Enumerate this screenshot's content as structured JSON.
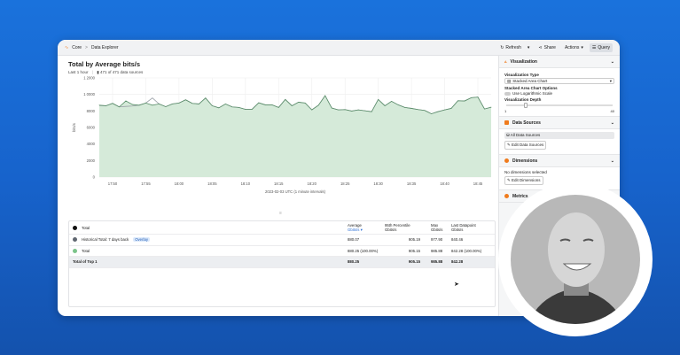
{
  "breadcrumb": {
    "root": "Core",
    "sep": ">",
    "page": "Data Explorer"
  },
  "toolbar": {
    "refresh": "Refresh",
    "share": "Share",
    "actions": "Actions",
    "query": "Query"
  },
  "chart_header": {
    "title": "Total by Average bits/s",
    "range": "Last 1 hour",
    "sources": "471 of 471 data sources"
  },
  "chart_data": {
    "type": "area",
    "title": "Total by Average bits/s",
    "xlabel": "2023-02-03 UTC (1 minute intervals)",
    "ylabel": "bits/s",
    "ylim": [
      0,
      12000
    ],
    "yticks": [
      "0",
      "2000",
      "4000",
      "6000",
      "8000",
      "1 0000",
      "1 2000"
    ],
    "xticks": [
      "17:50",
      "17:55",
      "18:00",
      "18:05",
      "18:10",
      "18:15",
      "18:20",
      "18:25",
      "18:30",
      "18:35",
      "18:40",
      "18:45"
    ],
    "x_start": "17:48",
    "x_step_min": 1,
    "series": [
      {
        "name": "Total",
        "color": "#5a8f6a",
        "fill": "#d5ead9",
        "values": [
          8700,
          8630,
          8920,
          8490,
          9210,
          8780,
          8700,
          8960,
          8700,
          8850,
          8520,
          8850,
          8960,
          9350,
          8920,
          8850,
          9570,
          8630,
          8380,
          8850,
          8490,
          8420,
          8200,
          8200,
          8990,
          8740,
          8740,
          8420,
          9390,
          8630,
          9060,
          8960,
          8130,
          8700,
          9860,
          8350,
          8130,
          8170,
          7990,
          8130,
          8020,
          7910,
          9390,
          8630,
          9170,
          8740,
          8420,
          8310,
          8170,
          8060,
          7660,
          7910,
          8130,
          8310,
          9240,
          9210,
          9600,
          9680,
          8240,
          8450
        ]
      },
      {
        "name": "Historical Total: 7 days back",
        "color": "#9aa0a6",
        "values": [
          8650,
          8630,
          8920,
          8490,
          8550,
          8600,
          8700,
          8960,
          9570,
          8850,
          8520,
          8850,
          8960,
          9350,
          8920,
          8850,
          9570,
          8630,
          8380,
          8850,
          8490,
          8420,
          8200,
          8200,
          8990,
          8740,
          8740,
          8420,
          9390,
          8630,
          9060,
          8960,
          8130,
          8700,
          9860,
          8350,
          8130,
          8170,
          7990,
          8130,
          8020,
          7910,
          9390,
          8630,
          9170,
          8740,
          8420,
          8310,
          8170,
          8060,
          7660,
          7910,
          8130,
          8310,
          9240,
          9210,
          9600,
          9680,
          8240,
          8450
        ]
      }
    ]
  },
  "splitter": "≡",
  "table": {
    "header": {
      "name": "Total",
      "avg": "Average",
      "avg_unit": "Gbits/s",
      "p95": "95th Percentile",
      "p95_unit": "Gbits/s",
      "max": "Max",
      "max_unit": "Gbits/s",
      "last": "Last Datapoint",
      "last_unit": "Gbits/s"
    },
    "rows": [
      {
        "name": "Historical Total: 7 days back",
        "badge": "Overlay",
        "avg": "880.07",
        "p95": "905.19",
        "max": "977.90",
        "last": "840.46",
        "color": "#5f6670"
      },
      {
        "name": "Total",
        "avg": "880.25  (100.00%)",
        "p95": "905.15",
        "max": "985.88",
        "last": "842.28  (100.00%)",
        "color": "#7cc48a"
      }
    ],
    "total": {
      "name": "Total of Top 1",
      "avg": "880.25",
      "p95": "905.15",
      "max": "985.88",
      "last": "842.28"
    }
  },
  "sidebar": {
    "viz": {
      "title": "Visualization",
      "type_label": "Visualization Type",
      "type_value": "Stacked Area Chart",
      "opts_label": "Stacked Area Chart Options",
      "log_label": "Use Logarithmic Scale",
      "depth_label": "Visualization Depth",
      "depth_min": "1",
      "depth_max": "40",
      "depth_value": 8
    },
    "sources": {
      "title": "Data Sources",
      "all": "All Data Sources",
      "edit": "Edit Data Sources"
    },
    "dims": {
      "title": "Dimensions",
      "none": "No dimensions selected",
      "edit": "Edit Dimensions"
    },
    "metrics": {
      "title": "Metrics"
    }
  }
}
